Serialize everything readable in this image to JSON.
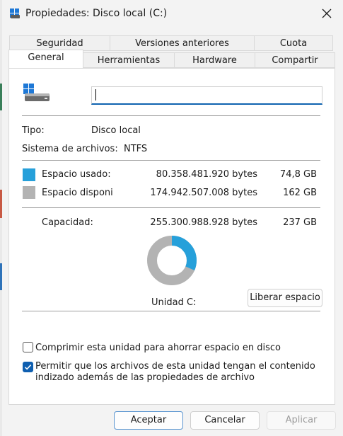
{
  "window": {
    "title": "Propiedades: Disco local (C:)"
  },
  "tabs_row1": [
    {
      "label": "Seguridad"
    },
    {
      "label": "Versiones anteriores"
    },
    {
      "label": "Cuota"
    }
  ],
  "tabs_row2": [
    {
      "label": "General",
      "active": true
    },
    {
      "label": "Herramientas"
    },
    {
      "label": "Hardware"
    },
    {
      "label": "Compartir"
    }
  ],
  "general": {
    "name_value": "",
    "type_label": "Tipo:",
    "type_value": "Disco local",
    "fs_label": "Sistema de archivos:",
    "fs_value": "NTFS",
    "used": {
      "label": "Espacio usado:",
      "bytes": "80.358.481.920 bytes",
      "size": "74,8 GB",
      "color": "#26a0da"
    },
    "free": {
      "label": "Espacio disponi",
      "bytes": "174.942.507.008 bytes",
      "size": "162 GB",
      "color": "#b3b3b3"
    },
    "capacity": {
      "label": "Capacidad:",
      "bytes": "255.300.988.928 bytes",
      "size": "237 GB"
    },
    "used_fraction": 0.3148,
    "drive_label": "Unidad C:",
    "cleanup_button": "Liberar espacio",
    "compress_checkbox": {
      "label": "Comprimir esta unidad para ahorrar espacio en disco",
      "checked": false
    },
    "index_checkbox": {
      "label_line1": "Permitir que los archivos de esta unidad tengan el contenido",
      "label_line2": "indizado además de las propiedades de archivo",
      "checked": true
    }
  },
  "footer": {
    "ok": "Aceptar",
    "cancel": "Cancelar",
    "apply": "Aplicar"
  },
  "icons": {
    "window": "drive-properties-icon",
    "close": "close-icon",
    "drive": "local-disk-icon",
    "check": "check-icon"
  }
}
